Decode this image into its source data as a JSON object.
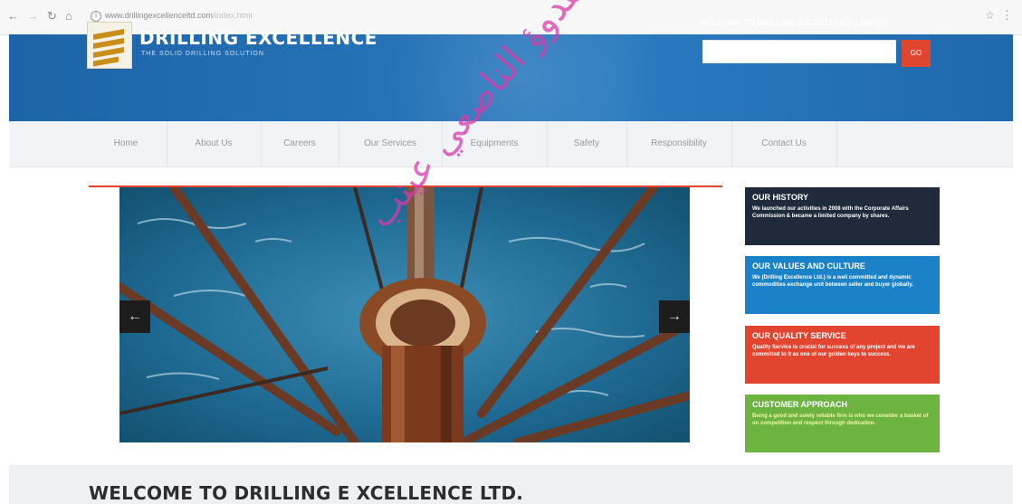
{
  "browser": {
    "url_main": "www.drillingexcellenceltd.com",
    "url_path": "/index.html"
  },
  "header": {
    "brand": "DRILLING EXCELLENCE",
    "tagline": "THE SOLID DRILLING SOLUTION",
    "welcome": "WELCOME TO DRILLING EXCELLENCE LIMITED",
    "search_value": "",
    "go_label": "GO"
  },
  "nav": {
    "items": [
      {
        "label": "Home"
      },
      {
        "label": "About Us"
      },
      {
        "label": "Careers"
      },
      {
        "label": "Our Services"
      },
      {
        "label": "Equipments"
      },
      {
        "label": "Safety"
      },
      {
        "label": "Responsibility"
      },
      {
        "label": "Contact Us"
      }
    ]
  },
  "slider": {
    "prev_icon": "arrow-left-icon",
    "next_icon": "arrow-right-icon"
  },
  "side": {
    "history": {
      "title": "OUR HISTORY",
      "text": "We launched our activities in 2008 with the Corporate Affairs Commission & became a limited company by shares.",
      "color": "#1f2b3a"
    },
    "values": {
      "title": "OUR VALUES AND CULTURE",
      "text": "We (Drilling Excellence Ltd.) is a well committed and dynamic commodities exchange unit between seller and buyer globally.",
      "color": "#1c82c7"
    },
    "quality": {
      "title": "OUR QUALITY SERVICE",
      "text": "Quality Service is crucial for success of any project and we are committed to it as one of our golden keys to success.",
      "color": "#e2452f"
    },
    "approach": {
      "title": "CUSTOMER APPROACH",
      "text": "Being a good and solely reliable firm is who we consider a basket of on competition and respect through dedication.",
      "color": "#6db33f"
    }
  },
  "main": {
    "welcome_title": "WELCOME TO DRILLING E XCELLENCE LTD."
  },
  "watermark": "هدوؤ الناصعي عينب"
}
